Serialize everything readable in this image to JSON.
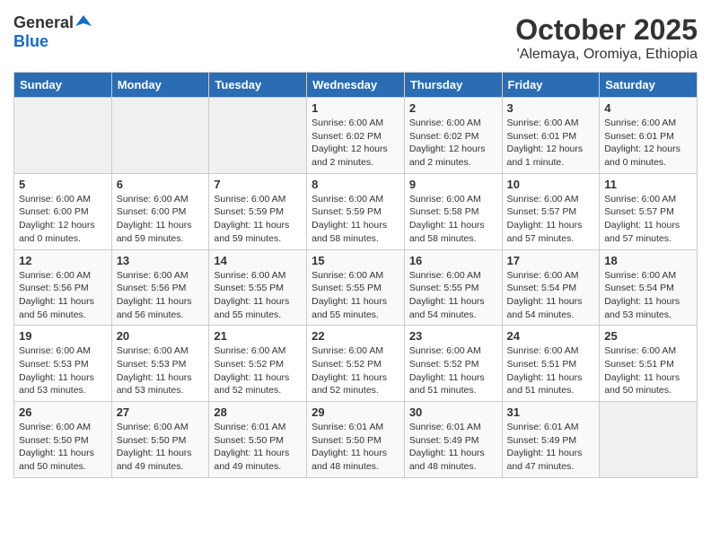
{
  "logo": {
    "general": "General",
    "blue": "Blue"
  },
  "title": "October 2025",
  "subtitle": "'Alemaya, Oromiya, Ethiopia",
  "weekdays": [
    "Sunday",
    "Monday",
    "Tuesday",
    "Wednesday",
    "Thursday",
    "Friday",
    "Saturday"
  ],
  "weeks": [
    [
      {
        "day": "",
        "info": ""
      },
      {
        "day": "",
        "info": ""
      },
      {
        "day": "",
        "info": ""
      },
      {
        "day": "1",
        "info": "Sunrise: 6:00 AM\nSunset: 6:02 PM\nDaylight: 12 hours and 2 minutes."
      },
      {
        "day": "2",
        "info": "Sunrise: 6:00 AM\nSunset: 6:02 PM\nDaylight: 12 hours and 2 minutes."
      },
      {
        "day": "3",
        "info": "Sunrise: 6:00 AM\nSunset: 6:01 PM\nDaylight: 12 hours and 1 minute."
      },
      {
        "day": "4",
        "info": "Sunrise: 6:00 AM\nSunset: 6:01 PM\nDaylight: 12 hours and 0 minutes."
      }
    ],
    [
      {
        "day": "5",
        "info": "Sunrise: 6:00 AM\nSunset: 6:00 PM\nDaylight: 12 hours and 0 minutes."
      },
      {
        "day": "6",
        "info": "Sunrise: 6:00 AM\nSunset: 6:00 PM\nDaylight: 11 hours and 59 minutes."
      },
      {
        "day": "7",
        "info": "Sunrise: 6:00 AM\nSunset: 5:59 PM\nDaylight: 11 hours and 59 minutes."
      },
      {
        "day": "8",
        "info": "Sunrise: 6:00 AM\nSunset: 5:59 PM\nDaylight: 11 hours and 58 minutes."
      },
      {
        "day": "9",
        "info": "Sunrise: 6:00 AM\nSunset: 5:58 PM\nDaylight: 11 hours and 58 minutes."
      },
      {
        "day": "10",
        "info": "Sunrise: 6:00 AM\nSunset: 5:57 PM\nDaylight: 11 hours and 57 minutes."
      },
      {
        "day": "11",
        "info": "Sunrise: 6:00 AM\nSunset: 5:57 PM\nDaylight: 11 hours and 57 minutes."
      }
    ],
    [
      {
        "day": "12",
        "info": "Sunrise: 6:00 AM\nSunset: 5:56 PM\nDaylight: 11 hours and 56 minutes."
      },
      {
        "day": "13",
        "info": "Sunrise: 6:00 AM\nSunset: 5:56 PM\nDaylight: 11 hours and 56 minutes."
      },
      {
        "day": "14",
        "info": "Sunrise: 6:00 AM\nSunset: 5:55 PM\nDaylight: 11 hours and 55 minutes."
      },
      {
        "day": "15",
        "info": "Sunrise: 6:00 AM\nSunset: 5:55 PM\nDaylight: 11 hours and 55 minutes."
      },
      {
        "day": "16",
        "info": "Sunrise: 6:00 AM\nSunset: 5:55 PM\nDaylight: 11 hours and 54 minutes."
      },
      {
        "day": "17",
        "info": "Sunrise: 6:00 AM\nSunset: 5:54 PM\nDaylight: 11 hours and 54 minutes."
      },
      {
        "day": "18",
        "info": "Sunrise: 6:00 AM\nSunset: 5:54 PM\nDaylight: 11 hours and 53 minutes."
      }
    ],
    [
      {
        "day": "19",
        "info": "Sunrise: 6:00 AM\nSunset: 5:53 PM\nDaylight: 11 hours and 53 minutes."
      },
      {
        "day": "20",
        "info": "Sunrise: 6:00 AM\nSunset: 5:53 PM\nDaylight: 11 hours and 53 minutes."
      },
      {
        "day": "21",
        "info": "Sunrise: 6:00 AM\nSunset: 5:52 PM\nDaylight: 11 hours and 52 minutes."
      },
      {
        "day": "22",
        "info": "Sunrise: 6:00 AM\nSunset: 5:52 PM\nDaylight: 11 hours and 52 minutes."
      },
      {
        "day": "23",
        "info": "Sunrise: 6:00 AM\nSunset: 5:52 PM\nDaylight: 11 hours and 51 minutes."
      },
      {
        "day": "24",
        "info": "Sunrise: 6:00 AM\nSunset: 5:51 PM\nDaylight: 11 hours and 51 minutes."
      },
      {
        "day": "25",
        "info": "Sunrise: 6:00 AM\nSunset: 5:51 PM\nDaylight: 11 hours and 50 minutes."
      }
    ],
    [
      {
        "day": "26",
        "info": "Sunrise: 6:00 AM\nSunset: 5:50 PM\nDaylight: 11 hours and 50 minutes."
      },
      {
        "day": "27",
        "info": "Sunrise: 6:00 AM\nSunset: 5:50 PM\nDaylight: 11 hours and 49 minutes."
      },
      {
        "day": "28",
        "info": "Sunrise: 6:01 AM\nSunset: 5:50 PM\nDaylight: 11 hours and 49 minutes."
      },
      {
        "day": "29",
        "info": "Sunrise: 6:01 AM\nSunset: 5:50 PM\nDaylight: 11 hours and 48 minutes."
      },
      {
        "day": "30",
        "info": "Sunrise: 6:01 AM\nSunset: 5:49 PM\nDaylight: 11 hours and 48 minutes."
      },
      {
        "day": "31",
        "info": "Sunrise: 6:01 AM\nSunset: 5:49 PM\nDaylight: 11 hours and 47 minutes."
      },
      {
        "day": "",
        "info": ""
      }
    ]
  ]
}
